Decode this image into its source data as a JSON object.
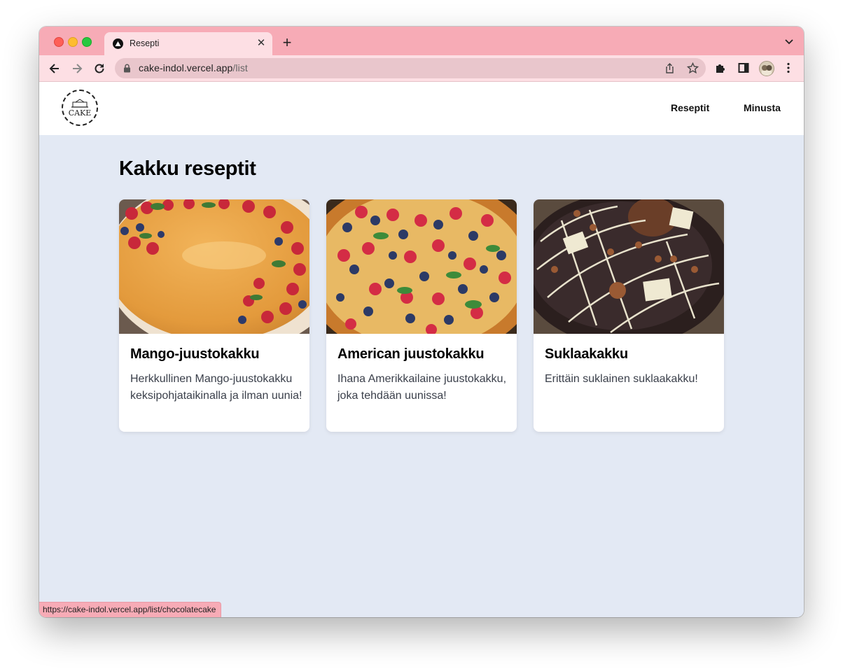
{
  "browser": {
    "tab_title": "Resepti",
    "url_host": "cake-indol.vercel.app",
    "url_path": "/list",
    "status_url": "https://cake-indol.vercel.app/list/chocolatecake"
  },
  "site": {
    "logo_text": "CAKE",
    "nav": {
      "recipes": "Reseptit",
      "about": "Minusta"
    },
    "page_title": "Kakku reseptit"
  },
  "recipes": [
    {
      "title": "Mango-juustokakku",
      "description": "Herkkullinen Mango-juustokakku keksipohjataikinalla ja ilman uunia!"
    },
    {
      "title": "American juustokakku",
      "description": "Ihana Amerikkailaine juustokakku, joka tehdään uunissa!"
    },
    {
      "title": "Suklaakakku",
      "description": "Erittäin suklainen suklaakakku!"
    }
  ],
  "colors": {
    "tabstrip": "#f7abb6",
    "toolbar": "#fddfe4",
    "page_background": "#e3e9f4"
  }
}
